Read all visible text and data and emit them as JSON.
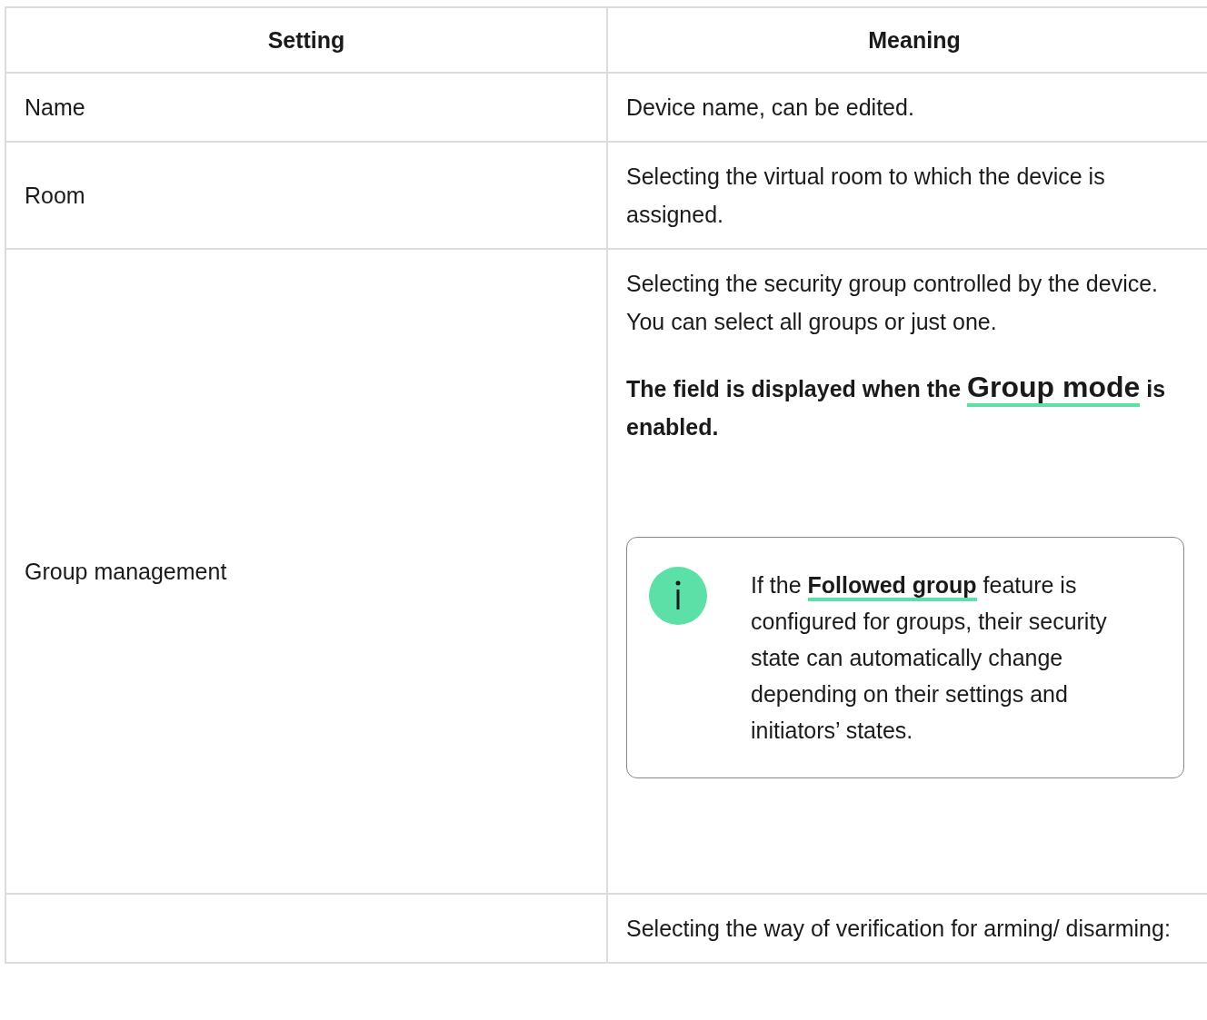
{
  "table": {
    "columns": [
      "Setting",
      "Meaning"
    ],
    "rows": [
      {
        "setting": "Name",
        "meaning": [
          {
            "kind": "paragraph",
            "text": "Device name, can be edited."
          }
        ]
      },
      {
        "setting": "Room",
        "meaning": [
          {
            "kind": "paragraph",
            "text": "Selecting the virtual room to which the device is assigned."
          }
        ]
      },
      {
        "setting": "Group management",
        "meaning": [
          {
            "kind": "paragraph",
            "text": "Selecting the security group controlled by the device. You can select all groups or just one."
          },
          {
            "kind": "bold_note",
            "before": "The field is displayed when the",
            "link": "Group mode",
            "after": "is enabled."
          },
          {
            "kind": "info_box",
            "before": "If the",
            "link": "Followed group",
            "after": "feature is configured for groups, their security state can automatically change depending on their settings and initiators’ states."
          }
        ]
      },
      {
        "setting": "",
        "meaning": [
          {
            "kind": "paragraph",
            "text": "Selecting the way of verification for arming/ disarming:"
          }
        ]
      }
    ]
  }
}
